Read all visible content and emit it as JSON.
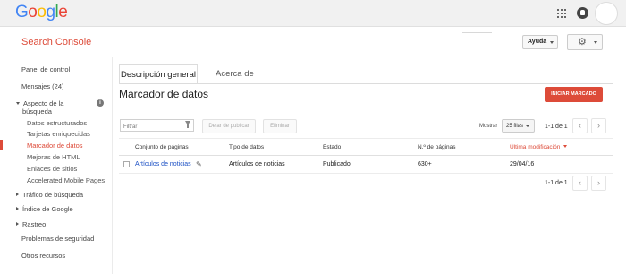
{
  "topbar": {
    "logo_letters": [
      {
        "ch": "G",
        "color": "#4285f4"
      },
      {
        "ch": "o",
        "color": "#ea4335"
      },
      {
        "ch": "o",
        "color": "#fbbc05"
      },
      {
        "ch": "g",
        "color": "#4285f4"
      },
      {
        "ch": "l",
        "color": "#34a853"
      },
      {
        "ch": "e",
        "color": "#ea4335"
      }
    ],
    "icons": [
      "apps-icon",
      "notifications-icon",
      "avatar"
    ]
  },
  "header": {
    "product_name": "Search Console",
    "help_label": "Ayuda",
    "settings_icon": "gear-icon"
  },
  "sidebar": {
    "items": [
      {
        "label": "Panel de control",
        "type": "top"
      },
      {
        "label": "Mensajes (24)",
        "type": "top"
      },
      {
        "label": "Aspecto de la",
        "type": "section-open"
      },
      {
        "label": "búsqueda",
        "type": "section-cont"
      },
      {
        "label": "Datos estructurados",
        "type": "sub"
      },
      {
        "label": "Tarjetas enriquecidas",
        "type": "sub"
      },
      {
        "label": "Marcador de datos",
        "type": "sub-active"
      },
      {
        "label": "Mejoras de HTML",
        "type": "sub"
      },
      {
        "label": "Enlaces de sitios",
        "type": "sub"
      },
      {
        "label": "Accelerated Mobile Pages",
        "type": "sub"
      },
      {
        "label": "Tráfico de búsqueda",
        "type": "section"
      },
      {
        "label": "Índice de Google",
        "type": "section"
      },
      {
        "label": "Rastreo",
        "type": "section"
      },
      {
        "label": "Problemas de seguridad",
        "type": "top"
      },
      {
        "label": "Otros recursos",
        "type": "top"
      }
    ],
    "info_badge": "i",
    "accent": "#dd4b39"
  },
  "main": {
    "tabs": [
      {
        "label": "Descripción general",
        "active": true
      },
      {
        "label": "Acerca de",
        "active": false
      }
    ],
    "title": "Marcador de datos",
    "start_button": "INICIAR MARCADO",
    "toolbar": {
      "filter_placeholder": "Filtrar",
      "unpublish_label": "Dejar de publicar",
      "delete_label": "Eliminar",
      "show_label": "Mostrar",
      "rows_selected": "25 filas",
      "range_text": "1-1 de 1"
    },
    "table": {
      "headers": [
        "Conjunto de páginas",
        "Tipo de datos",
        "Estado",
        "N.º de páginas",
        "Última modificación"
      ],
      "sorted_column": 4,
      "rows": [
        [
          "Artículos de noticias",
          "Artículos de noticias",
          "Publicado",
          "630+",
          "29/04/16"
        ]
      ]
    },
    "footer_range_text": "1-1 de 1",
    "link_color": "#1a4fc4"
  }
}
